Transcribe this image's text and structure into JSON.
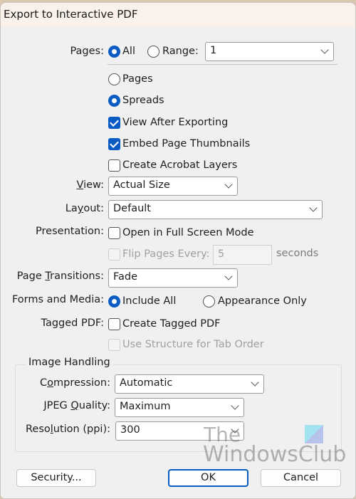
{
  "window": {
    "title": "Export to Interactive PDF"
  },
  "pages": {
    "label": "Pages:",
    "all_label": "All",
    "all_selected": true,
    "range_label": "Range:",
    "range_selected": false,
    "range_value": "1",
    "pages_label": "Pages",
    "pages_selected": false,
    "spreads_label": "Spreads",
    "spreads_selected": true
  },
  "options": {
    "view_after_exporting": {
      "label": "View After Exporting",
      "checked": true
    },
    "embed_page_thumbnails": {
      "label": "Embed Page Thumbnails",
      "checked": true
    },
    "create_acrobat_layers": {
      "label": "Create Acrobat Layers",
      "checked": false
    }
  },
  "view": {
    "label_prefix": "",
    "label_u": "V",
    "label_rest": "iew:",
    "value": "Actual Size"
  },
  "layout": {
    "label_prefix": "La",
    "label_u": "y",
    "label_rest": "out:",
    "value": "Default"
  },
  "presentation": {
    "label": "Presentation:",
    "full_screen_label": "Open in Full Screen Mode",
    "full_screen_checked": false,
    "flip_pages_label": "Flip Pages Every:",
    "flip_pages_checked": false,
    "flip_pages_value": "5",
    "seconds_label": "seconds"
  },
  "page_transitions": {
    "label_prefix": "Page ",
    "label_u": "T",
    "label_rest": "ransitions:",
    "value": "Fade"
  },
  "forms_media": {
    "label": "Forms and Media:",
    "include_all_label": "Include All",
    "include_all_selected": true,
    "appearance_only_label": "Appearance Only",
    "appearance_only_selected": false
  },
  "tagged_pdf": {
    "label": "Tagged PDF:",
    "create_label": "Create Tagged PDF",
    "create_checked": false,
    "structure_label": "Use Structure for Tab Order",
    "structure_checked": false
  },
  "image_handling": {
    "title": "Image Handling",
    "compression": {
      "label_prefix": "C",
      "label_u": "o",
      "label_rest": "mpression:",
      "value": "Automatic"
    },
    "jpeg_quality": {
      "label_prefix": "JPEG ",
      "label_u": "Q",
      "label_rest": "uality:",
      "value": "Maximum"
    },
    "resolution": {
      "label_prefix": "Reso",
      "label_u": "l",
      "label_rest": "ution (ppi):",
      "value": "300"
    }
  },
  "buttons": {
    "security": "Security...",
    "ok": "OK",
    "cancel": "Cancel"
  },
  "watermark": {
    "line1": "The",
    "line2": "WindowsClub"
  }
}
